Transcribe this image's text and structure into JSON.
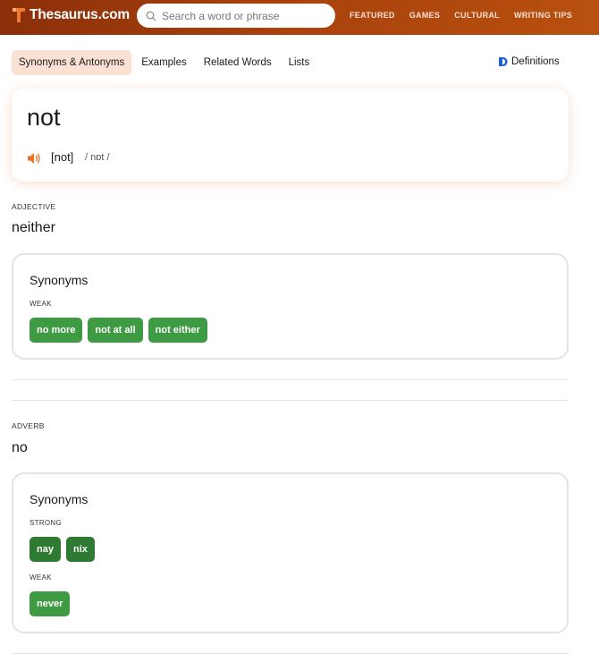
{
  "header": {
    "logo_text": "Thesaurus.com",
    "search_placeholder": "Search a word or phrase",
    "nav": [
      "FEATURED",
      "GAMES",
      "CULTURAL",
      "WRITING TIPS"
    ],
    "brand_color": "#a8410c"
  },
  "tabs": {
    "items": [
      "Synonyms & Antonyms",
      "Examples",
      "Related Words",
      "Lists"
    ],
    "active": "Synonyms & Antonyms",
    "definitions_label": "Definitions"
  },
  "word": {
    "headword": "not",
    "pronunciation": "[not]",
    "ipa": "/ nɒt /"
  },
  "senses": [
    {
      "pos": "ADJECTIVE",
      "sense": "neither",
      "synonyms_title": "Synonyms",
      "groups": [
        {
          "strength": "WEAK",
          "words": [
            "no more",
            "not at all",
            "not either"
          ]
        }
      ]
    },
    {
      "pos": "ADVERB",
      "sense": "no",
      "synonyms_title": "Synonyms",
      "groups": [
        {
          "strength": "STRONG",
          "words": [
            "nay",
            "nix"
          ]
        },
        {
          "strength": "WEAK",
          "words": [
            "never"
          ]
        }
      ]
    }
  ],
  "colors": {
    "chip_weak": "#3f9a44",
    "chip_strong": "#2f7a33",
    "active_tab": "#fbe1d4",
    "speaker": "#e8742a"
  }
}
